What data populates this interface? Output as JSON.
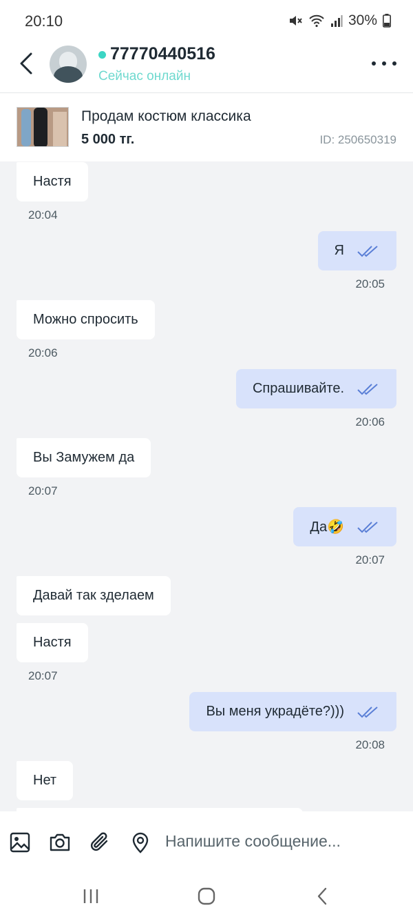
{
  "status_bar": {
    "time": "20:10",
    "battery": "30%"
  },
  "header": {
    "contact_name": "77770440516",
    "contact_status": "Сейчас онлайн"
  },
  "ad": {
    "title": "Продам костюм классика",
    "price": "5 000 тг.",
    "id": "ID: 250650319"
  },
  "messages": [
    {
      "dir": "in",
      "text": "Настя",
      "time": "20:04"
    },
    {
      "dir": "out",
      "text": "Я",
      "time": "20:05"
    },
    {
      "dir": "in",
      "text": "Можно спросить",
      "time": "20:06"
    },
    {
      "dir": "out",
      "text": "Спрашивайте.",
      "time": "20:06"
    },
    {
      "dir": "in",
      "text": "Вы Замужем да",
      "time": "20:07"
    },
    {
      "dir": "out",
      "text": "Да🤣",
      "time": "20:07"
    },
    {
      "dir": "in",
      "text": "Давай так зделаем",
      "time": ""
    },
    {
      "dir": "in",
      "text": "Настя",
      "time": "20:07"
    },
    {
      "dir": "out",
      "text": "Вы меня украдёте?)))",
      "time": "20:08"
    },
    {
      "dir": "in",
      "text": "Нет",
      "time": ""
    }
  ],
  "composer": {
    "placeholder": "Напишите сообщение..."
  },
  "colors": {
    "accent": "#3cd5c4",
    "outgoing_bubble": "#d8e2fb",
    "incoming_bubble": "#ffffff",
    "read_ticks": "#5a7fd6"
  }
}
